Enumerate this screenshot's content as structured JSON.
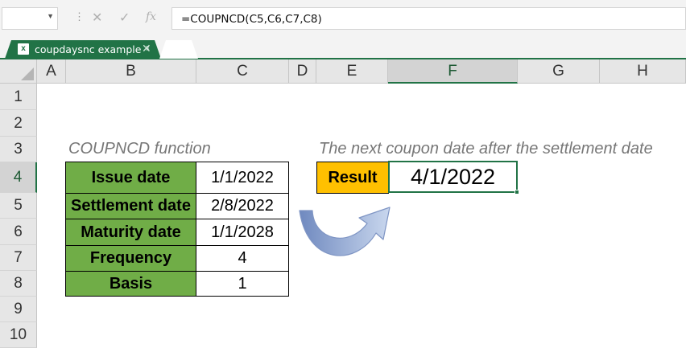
{
  "formula_bar": {
    "name_box": "",
    "cancel_icon": "✕",
    "enter_icon": "✓",
    "fx_label": "fx",
    "formula": "=COUPNCD(C5,C6,C7,C8)"
  },
  "workbook_tab": {
    "name": "coupdaysnc example *",
    "close": "✕",
    "icon_letter": "x"
  },
  "columns": [
    "A",
    "B",
    "C",
    "D",
    "E",
    "F",
    "G",
    "H"
  ],
  "selected_column": "F",
  "rows": [
    "1",
    "2",
    "3",
    "4",
    "5",
    "6",
    "7",
    "8",
    "9",
    "10"
  ],
  "selected_row": "4",
  "captions": {
    "left": "COUPNCD function",
    "right": "The next coupon date after the settlement date"
  },
  "table": [
    {
      "label": "Issue date",
      "value": "1/1/2022"
    },
    {
      "label": "Settlement date",
      "value": "2/8/2022"
    },
    {
      "label": "Maturity date",
      "value": "1/1/2028"
    },
    {
      "label": "Frequency",
      "value": "4"
    },
    {
      "label": "Basis",
      "value": "1"
    }
  ],
  "result": {
    "label": "Result",
    "value": "4/1/2022"
  },
  "colors": {
    "accent": "#217346",
    "label_fill": "#70ad47",
    "result_fill": "#ffc000",
    "arrow": "#8ea9db"
  },
  "icons": {
    "arrow": "curved-u-turn-arrow-icon"
  }
}
